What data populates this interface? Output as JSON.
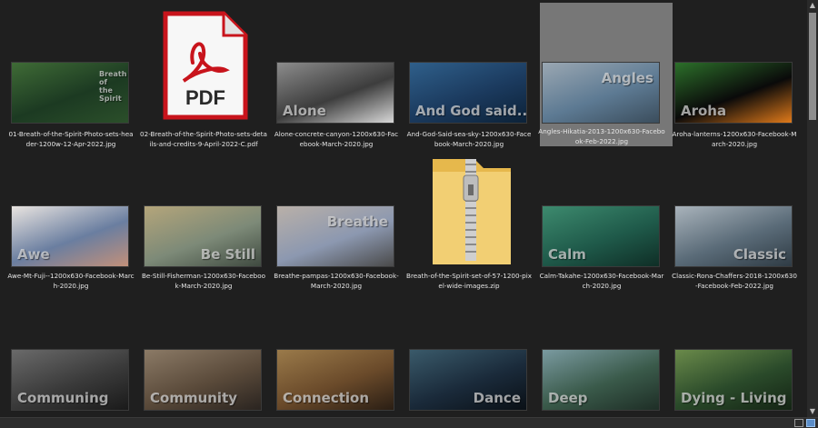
{
  "files": [
    {
      "name": "01-Breath-of-the-Spirit-Photo-sets-header-1200w-12-Apr-2022.jpg",
      "overlay": "Breath of the Spirit",
      "kind": "image",
      "colors": [
        "#1c3a22",
        "#3f6b36",
        "#2b4f2a"
      ]
    },
    {
      "name": "02-Breath-of-the-Spirit-Photo-sets-details-and-credits-9-April-2022-C.pdf",
      "overlay": "PDF",
      "kind": "pdf",
      "colors": [
        "#c8141c",
        "#f4f4f4"
      ]
    },
    {
      "name": "Alone-concrete-canyon-1200x630-Facebook-March-2020.jpg",
      "overlay": "Alone",
      "kind": "image",
      "colors": [
        "#3d3d3d",
        "#8c8c8c",
        "#d8d8d8"
      ]
    },
    {
      "name": "And-God-Said-sea-sky-1200x630-Facebook-March-2020.jpg",
      "overlay": "And God said...",
      "kind": "image",
      "colors": [
        "#1b3a5e",
        "#2f5f8a",
        "#0c2238"
      ]
    },
    {
      "name": "Angles-Hikatia-2013-1200x630-Facebook-Feb-2022.jpg",
      "overlay": "Angles",
      "kind": "image",
      "colors": [
        "#5d7a93",
        "#9aa7b2",
        "#3b4d5c"
      ]
    },
    {
      "name": "Aroha-lanterns-1200x630-Facebook-March-2020.jpg",
      "overlay": "Aroha",
      "kind": "image",
      "colors": [
        "#0a0a0a",
        "#2c6f2a",
        "#e07a1a"
      ]
    },
    {
      "name": "Awe-Mt-Fuji--1200x630-Facebook-March-2020.jpg",
      "overlay": "Awe",
      "kind": "image",
      "colors": [
        "#6a7ea0",
        "#e9e4e0",
        "#c2907a"
      ]
    },
    {
      "name": "Be-Still-Fisherman-1200x630-Facebook-March-2020.jpg",
      "overlay": "Be Still",
      "kind": "image",
      "colors": [
        "#7d8a78",
        "#b4a57a",
        "#3f4a40"
      ]
    },
    {
      "name": "Breathe-pampas-1200x630-Facebook-March-2020.jpg",
      "overlay": "Breathe",
      "kind": "image",
      "colors": [
        "#8c98b0",
        "#b9b0a8",
        "#4a4a4a"
      ]
    },
    {
      "name": "Breath-of-the-Spirit-set-of-57-1200-pixel-wide-images.zip",
      "overlay": "",
      "kind": "zip",
      "colors": [
        "#f2cf73",
        "#e6b84c",
        "#c9c9c9"
      ]
    },
    {
      "name": "Calm-Takahe-1200x630-Facebook-March-2020.jpg",
      "overlay": "Calm",
      "kind": "image",
      "colors": [
        "#1f5a4a",
        "#3d8a6e",
        "#0f2e26"
      ]
    },
    {
      "name": "Classic-Rona-Chaffers-2018-1200x630-Facebook-Feb-2022.jpg",
      "overlay": "Classic",
      "kind": "image",
      "colors": [
        "#5a6b78",
        "#a9b3bb",
        "#2f3b44"
      ]
    },
    {
      "name": "",
      "overlay": "Communing",
      "kind": "image",
      "colors": [
        "#3a3a3a",
        "#6a6a6a",
        "#1a1a1a"
      ]
    },
    {
      "name": "",
      "overlay": "Community",
      "kind": "image",
      "colors": [
        "#5a4a3a",
        "#8b7a66",
        "#2a2420"
      ]
    },
    {
      "name": "",
      "overlay": "Connection",
      "kind": "image",
      "colors": [
        "#6a4a2a",
        "#9a7a4a",
        "#2a1e14"
      ]
    },
    {
      "name": "",
      "overlay": "Dance",
      "kind": "image",
      "colors": [
        "#1a2a3a",
        "#3a5a6a",
        "#0a1016"
      ]
    },
    {
      "name": "",
      "overlay": "Deep",
      "kind": "image",
      "colors": [
        "#3a5a4a",
        "#7a9aa0",
        "#1e2e26"
      ]
    },
    {
      "name": "",
      "overlay": "Dying - Living",
      "kind": "image",
      "colors": [
        "#2a4a2a",
        "#6a8a4a",
        "#142414"
      ]
    }
  ]
}
